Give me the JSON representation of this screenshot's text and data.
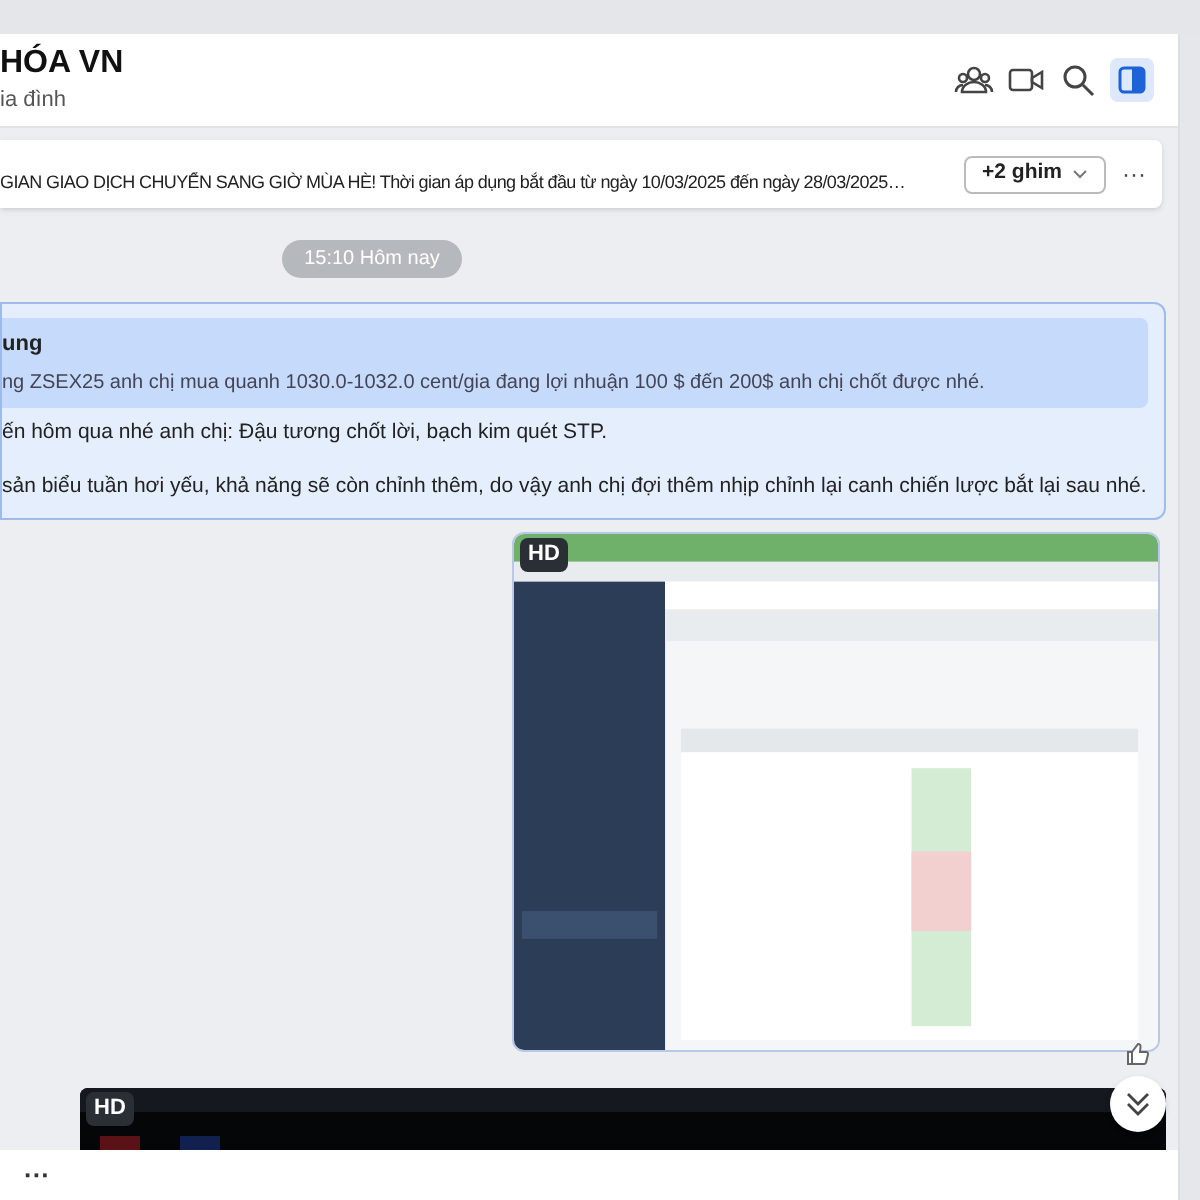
{
  "header": {
    "title": "HÓA VN",
    "subtitle": "ia đình"
  },
  "pinned": {
    "text": "GIAN GIAO DỊCH CHUYỂN SANG GIỜ MÙA HÈ! Thời gian áp dụng bắt đầu từ ngày 10/03/2025 đến ngày 28/03/2025…",
    "more_pins": "+2 ghim",
    "menu": "···"
  },
  "time_divider": "15:10 Hôm nay",
  "message": {
    "quote": {
      "author": "ung",
      "text": "ng ZSEX25 anh chị mua quanh 1030.0-1032.0 cent/gia đang lợi nhuận 100 $ đến 200$ anh chị chốt được nhé."
    },
    "paragraphs": [
      "ến hôm qua nhé anh chị: Đậu tương chốt lời, bạch kim quét STP.",
      "sản biểu tuần hơi yếu, khả năng sẽ còn chỉnh thêm, do vậy anh chị đợi thêm nhịp chỉnh lại canh chiến lược bắt lại sau nhé."
    ]
  },
  "images": [
    {
      "kind": "picture",
      "badge": "HD"
    },
    {
      "kind": "picture",
      "badge": "HD"
    }
  ],
  "composer": {
    "menu": "···"
  }
}
